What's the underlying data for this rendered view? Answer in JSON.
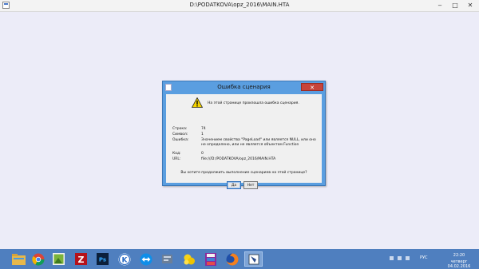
{
  "window": {
    "title": "D:\\PODATKOVA\\opz_2016\\MAIN.HTA",
    "minimize_glyph": "‒",
    "maximize_glyph": "□",
    "close_glyph": "✕"
  },
  "dialog": {
    "title": "Ошибка сценария",
    "close_glyph": "✕",
    "message": "На этой странице произошла ошибка сценария.",
    "fields": {
      "line_label": "Строка:",
      "line_value": "74",
      "char_label": "Символ:",
      "char_value": "1",
      "error_label": "Ошибка:",
      "error_value": "Значением свойства \"PageLoad\" или является NULL, или оно не определено, или не является объектом Function",
      "code_label": "Код:",
      "code_value": "0",
      "url_label": "URL:",
      "url_value": "file:///D:/PODATKOVA/opz_2016/MAIN.HTA"
    },
    "question": "Вы хотите продолжить выполнение сценариев на этой странице?",
    "yes_label": "Да",
    "no_label": "Нет"
  },
  "taskbar": {
    "icons": [
      "file-explorer-icon",
      "chrome-icon",
      "image-viewer-icon",
      "filezilla-icon",
      "photoshop-icon",
      "k-app-icon",
      "teamviewer-icon",
      "tools-icon",
      "messenger-icon",
      "archive-icon",
      "firefox-icon",
      "active-hta-icon"
    ],
    "lang": "РУС",
    "time": "22:20",
    "date": "четверг 04.02.2016"
  }
}
